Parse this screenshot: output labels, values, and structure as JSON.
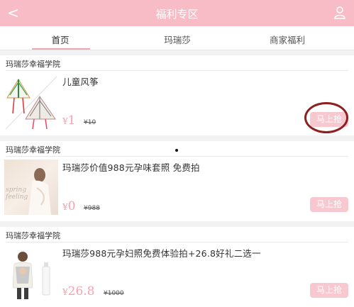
{
  "header": {
    "back_icon": "<",
    "title": "福利专区"
  },
  "tabs": [
    {
      "label": "首页"
    },
    {
      "label": "玛瑞莎"
    },
    {
      "label": "商家福利"
    }
  ],
  "items": [
    {
      "shop": "玛瑞莎幸福学院",
      "name": "儿童风筝",
      "currency": "¥",
      "price": "1",
      "original_price": "¥10",
      "buy_label": "马上抢",
      "thumb_icon": "kite-image"
    },
    {
      "shop": "玛瑞莎幸福学院",
      "name": "玛瑞莎价值988元孕味套照 免费拍",
      "currency": "¥",
      "price": "0",
      "original_price": "¥988",
      "buy_label": "马上抢",
      "thumb_icon": "maternity-photo-image",
      "thumb_text": "spring feeling"
    },
    {
      "shop": "玛瑞莎幸福学院",
      "name": "玛瑞莎988元孕妇照免费体验拍+26.8好礼二选一",
      "currency": "¥",
      "price": "26.8",
      "original_price": "¥1000",
      "buy_label": "马上抢",
      "thumb_icon": "baby-carrier-image"
    }
  ],
  "colors": {
    "header_bg": "#f7bcc6",
    "accent": "#f3a3b0",
    "button_bg": "#f8c8d0",
    "highlight": "#8e2020"
  }
}
